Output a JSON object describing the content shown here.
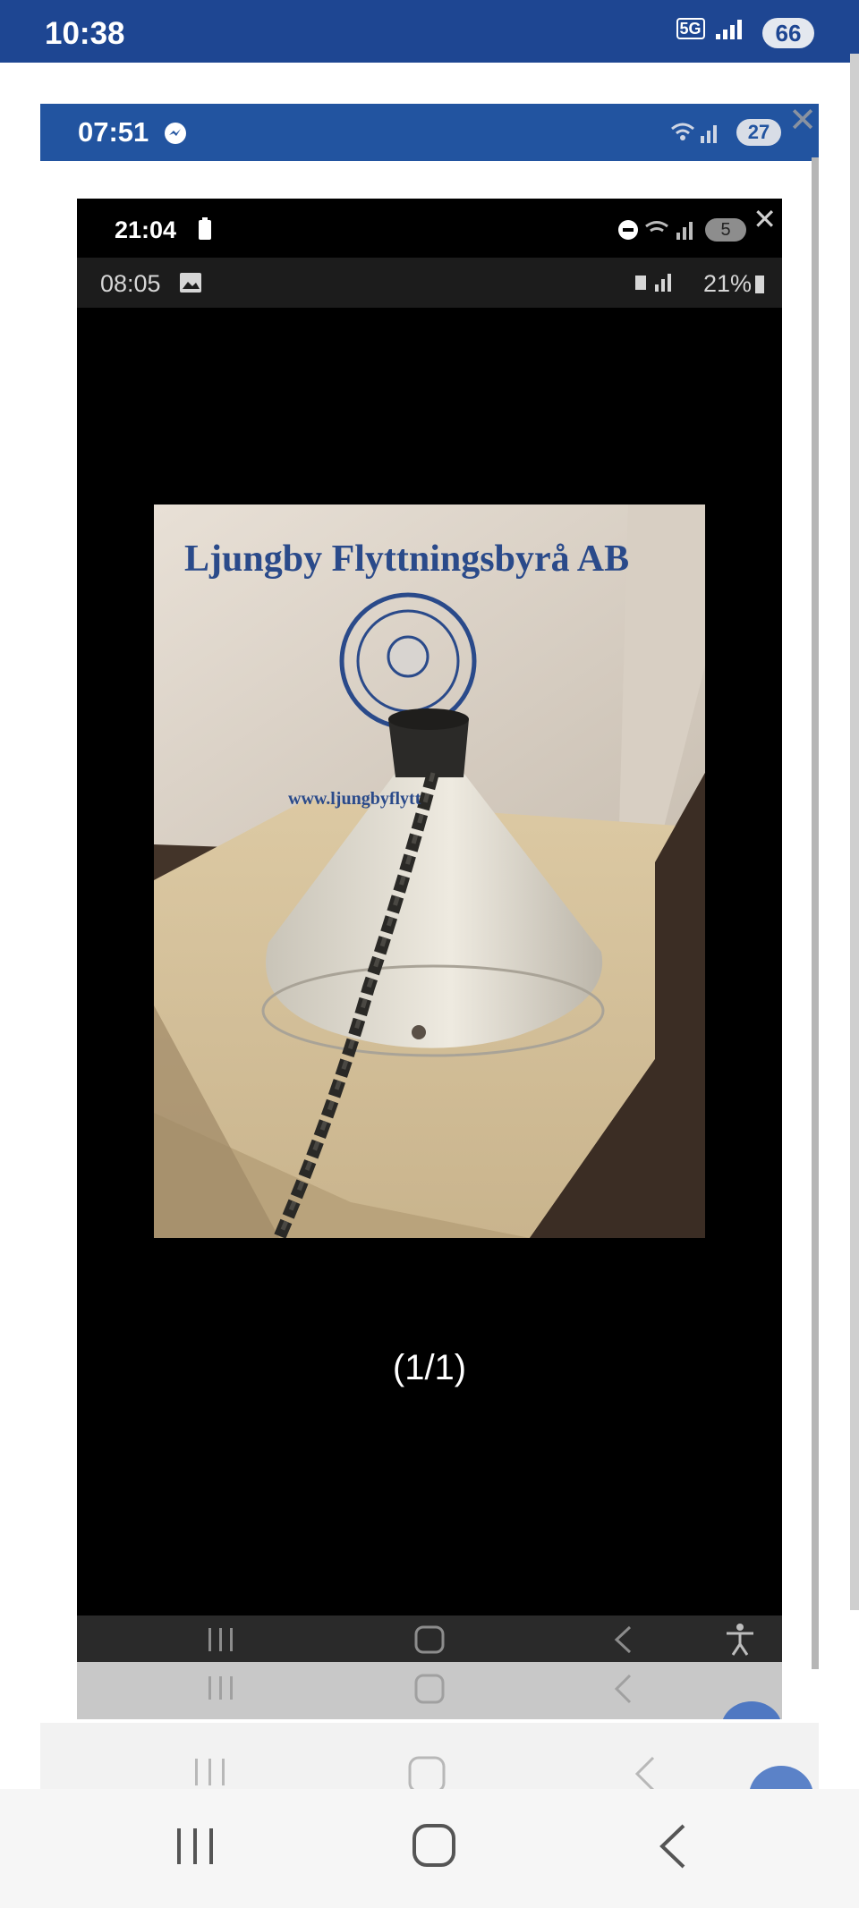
{
  "outer_status": {
    "time": "10:38",
    "network": "5G",
    "battery": "66"
  },
  "level1": {
    "time": "07:51",
    "battery": "27"
  },
  "level2": {
    "time": "21:04",
    "battery": "5"
  },
  "level3": {
    "time": "08:05",
    "battery_text": "21%"
  },
  "viewer": {
    "counter": "(1/1)"
  },
  "photo": {
    "box_text": "Ljungby Flyttningsbyrå AB",
    "box_url": "www.ljungbyflytt"
  },
  "colors": {
    "outer_status": "#1e4692",
    "level1_status": "#2254a0",
    "viewer_bg": "#000000"
  },
  "nav": {
    "recents_icon": "recents-icon",
    "home_icon": "home-icon",
    "back_icon": "back-icon",
    "accessibility_icon": "accessibility-icon"
  }
}
